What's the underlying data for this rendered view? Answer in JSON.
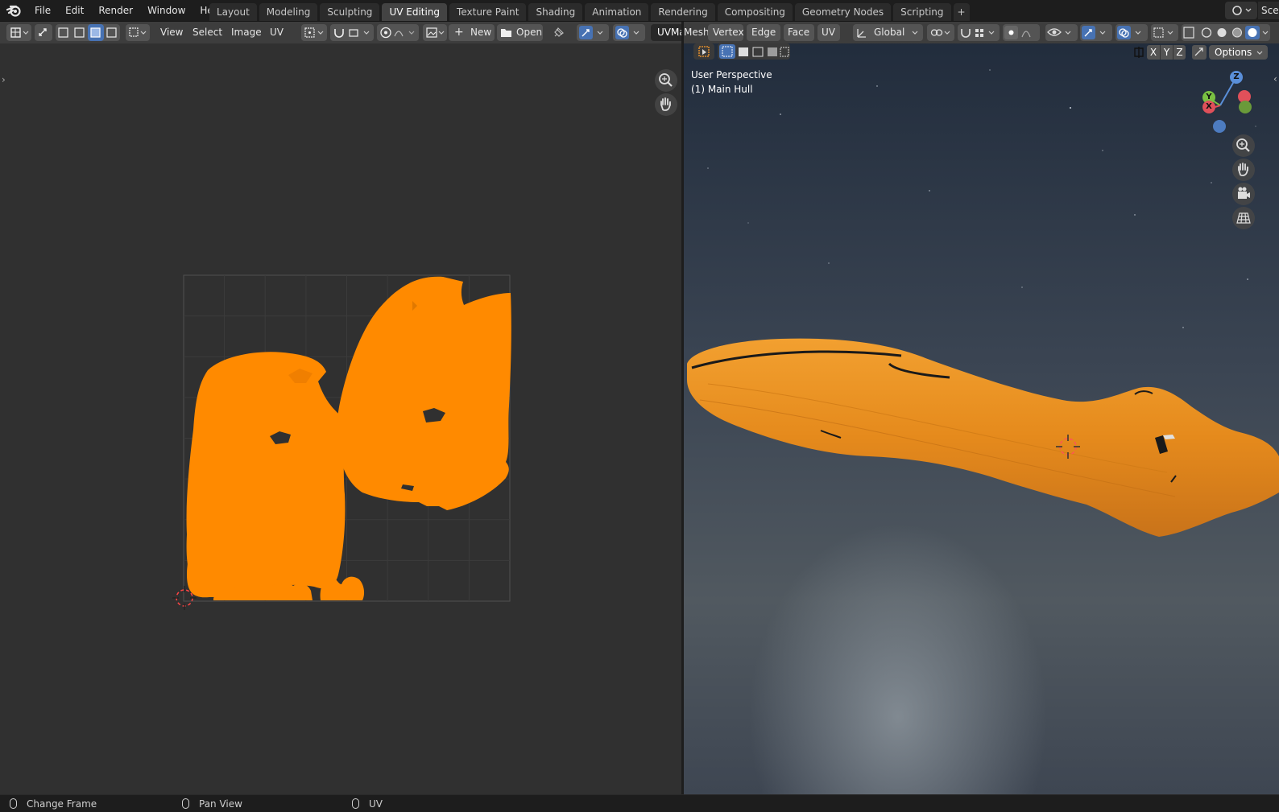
{
  "menu": {
    "items": [
      "File",
      "Edit",
      "Render",
      "Window",
      "Help"
    ]
  },
  "workspaces": {
    "tabs": [
      "Layout",
      "Modeling",
      "Sculpting",
      "UV Editing",
      "Texture Paint",
      "Shading",
      "Animation",
      "Rendering",
      "Compositing",
      "Geometry Nodes",
      "Scripting"
    ],
    "active": "UV Editing",
    "add_label": "+"
  },
  "scene": {
    "label": "Scen"
  },
  "uv_editor": {
    "menus": [
      "View",
      "Select",
      "Image",
      "UV"
    ],
    "new_label": "New",
    "open_label": "Open",
    "uvmap_label": "UVMa"
  },
  "view3d": {
    "menus": [
      "Mesh",
      "Vertex",
      "Edge",
      "Face",
      "UV"
    ],
    "orientation": "Global",
    "axis_buttons": [
      "X",
      "Y",
      "Z"
    ],
    "options_label": "Options",
    "overlay_line1": "User Perspective",
    "overlay_line2": "(1) Main Hull",
    "gizmo": {
      "x": "X",
      "y": "Y",
      "z": "Z"
    }
  },
  "statusbar": {
    "items": [
      "Change Frame",
      "Pan View",
      "UV"
    ]
  },
  "colors": {
    "accent": "#4772b3",
    "selection_orange": "#ff8a00",
    "hull_orange": "#e8901f"
  }
}
